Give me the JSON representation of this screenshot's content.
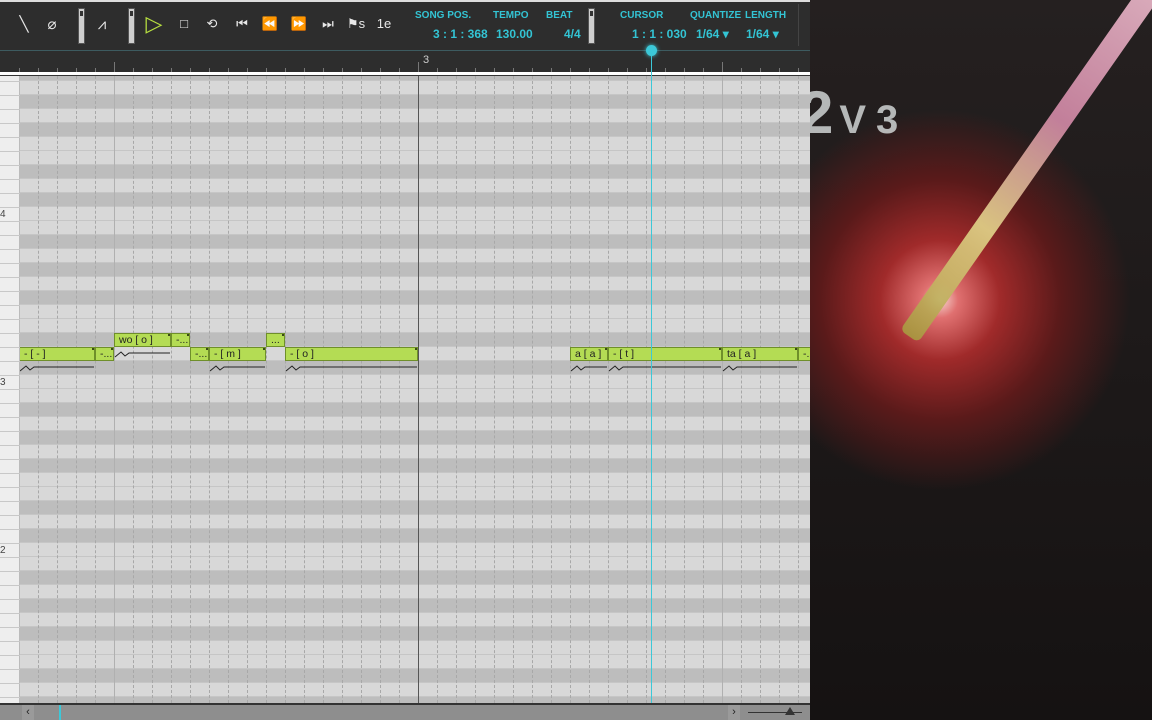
{
  "toolbar": {
    "tools": [
      {
        "name": "pencil-tool",
        "glyph": "╲"
      },
      {
        "name": "eraser-tool",
        "glyph": "⌀"
      },
      {
        "name": "pitch-curve-tool",
        "glyph": "⩘"
      }
    ],
    "transport": [
      {
        "name": "play-button",
        "glyph": "▷"
      },
      {
        "name": "stop-button",
        "glyph": "□"
      },
      {
        "name": "loop-button",
        "glyph": "⟲"
      },
      {
        "name": "go-to-start-button",
        "glyph": "⏮"
      },
      {
        "name": "rewind-button",
        "glyph": "⏪"
      },
      {
        "name": "fast-forward-button",
        "glyph": "⏩"
      },
      {
        "name": "go-to-end-button",
        "glyph": "⏭"
      },
      {
        "name": "start-marker-button",
        "glyph": "⚑s"
      },
      {
        "name": "end-marker-button",
        "glyph": "1e"
      }
    ],
    "song_pos_label": "SONG POS.",
    "song_pos": "3 : 1 : 368",
    "tempo_label": "TEMPO",
    "tempo": "130.00",
    "beat_label": "BEAT",
    "beat": "4/4",
    "cursor_label": "CURSOR",
    "cursor": "1 : 1 : 030",
    "quantize_label": "QUANTIZE",
    "quantize": "1/64 ▾",
    "length_label": "LENGTH",
    "length": "1/64 ▾"
  },
  "ruler": {
    "measure_label": "3"
  },
  "keyboard": {
    "octave_labels": [
      {
        "label": "4",
        "midi": 60
      },
      {
        "label": "3",
        "midi": 48
      },
      {
        "label": "2",
        "midi": 36
      }
    ]
  },
  "notes": [
    {
      "lyric": "- [ - ]",
      "midi": 50,
      "start16": 11,
      "end16": 15,
      "curve": true
    },
    {
      "lyric": "-...",
      "midi": 50,
      "start16": 15,
      "end16": 16,
      "curve": false
    },
    {
      "lyric": "wo [ o ]",
      "midi": 51,
      "start16": 16,
      "end16": 19,
      "curve": true
    },
    {
      "lyric": "-...",
      "midi": 51,
      "start16": 19,
      "end16": 20,
      "curve": false
    },
    {
      "lyric": "-...",
      "midi": 50,
      "start16": 20,
      "end16": 21,
      "curve": false
    },
    {
      "lyric": "- [ m ]",
      "midi": 50,
      "start16": 21,
      "end16": 24,
      "curve": true
    },
    {
      "lyric": "...",
      "midi": 51,
      "start16": 24,
      "end16": 25,
      "curve": false
    },
    {
      "lyric": "- [ o ]",
      "midi": 50,
      "start16": 25,
      "end16": 32,
      "curve": true
    },
    {
      "lyric": "a [ a ]",
      "midi": 50,
      "start16": 40,
      "end16": 42,
      "curve": true
    },
    {
      "lyric": "- [ t ]",
      "midi": 50,
      "start16": 42,
      "end16": 48,
      "curve": true
    },
    {
      "lyric": "ta [ a ]",
      "midi": 50,
      "start16": 48,
      "end16": 52,
      "curve": true
    },
    {
      "lyric": "-.",
      "midi": 50,
      "start16": 52,
      "end16": 54,
      "curve": false
    }
  ],
  "scrollbar": {
    "left": "‹",
    "right": "›"
  },
  "colors": {
    "note": "#b4dc54",
    "accent": "#33c4d4",
    "cursor": "#3cc8d8"
  },
  "background_logo": "2V3"
}
